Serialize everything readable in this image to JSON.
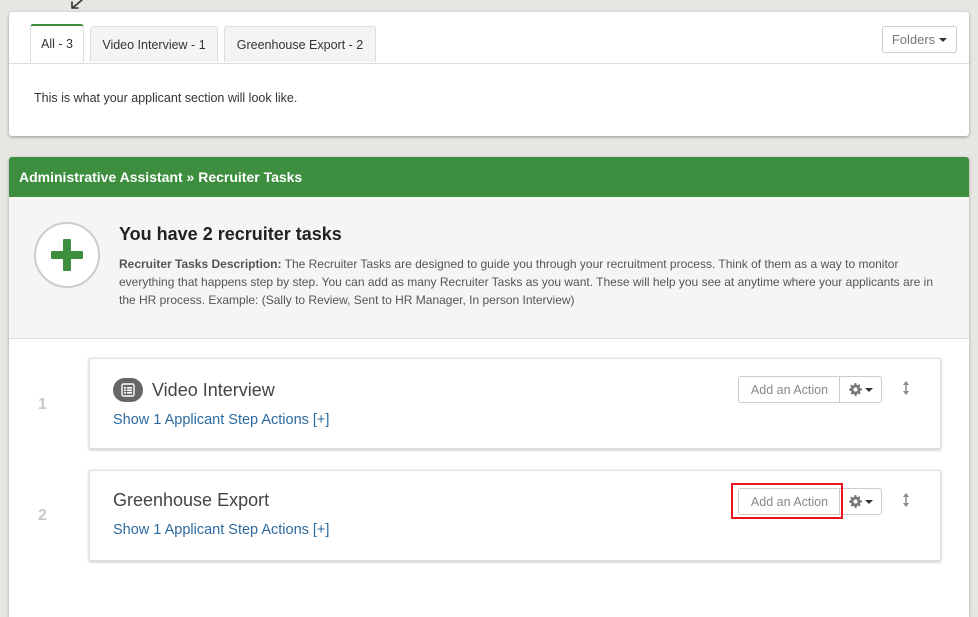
{
  "tabs": [
    {
      "label": "All - 3"
    },
    {
      "label": "Video Interview - 1"
    },
    {
      "label": "Greenhouse Export - 2"
    }
  ],
  "folders_label": "Folders",
  "applicant_section_text": "This is what your applicant section will look like.",
  "breadcrumb": "Administrative Assistant » Recruiter Tasks",
  "intro": {
    "title": "You have 2 recruiter tasks",
    "desc_label": "Recruiter Tasks Description:",
    "desc_text": " The Recruiter Tasks are designed to guide you through your recruitment process. Think of them as a way to monitor everything that happens step by step. You can add as many Recruiter Tasks as you want. These will help you see at anytime where your applicants are in the HR process. Example: (Sally to Review, Sent to HR Manager, In person Interview)"
  },
  "tasks": [
    {
      "number": "1",
      "title": "Video Interview",
      "link": "Show 1 Applicant Step Actions [+]",
      "action_label": "Add an Action"
    },
    {
      "number": "2",
      "title": "Greenhouse Export",
      "link": "Show 1 Applicant Step Actions [+]",
      "action_label": "Add an Action"
    }
  ],
  "colors": {
    "brand_green": "#3d8f3f",
    "link_blue": "#2d6a9f",
    "highlight_red": "#e8141c"
  },
  "icons": [
    "plus-icon",
    "list-icon",
    "gear-icon",
    "caret-down-icon",
    "sort-handle-icon"
  ]
}
